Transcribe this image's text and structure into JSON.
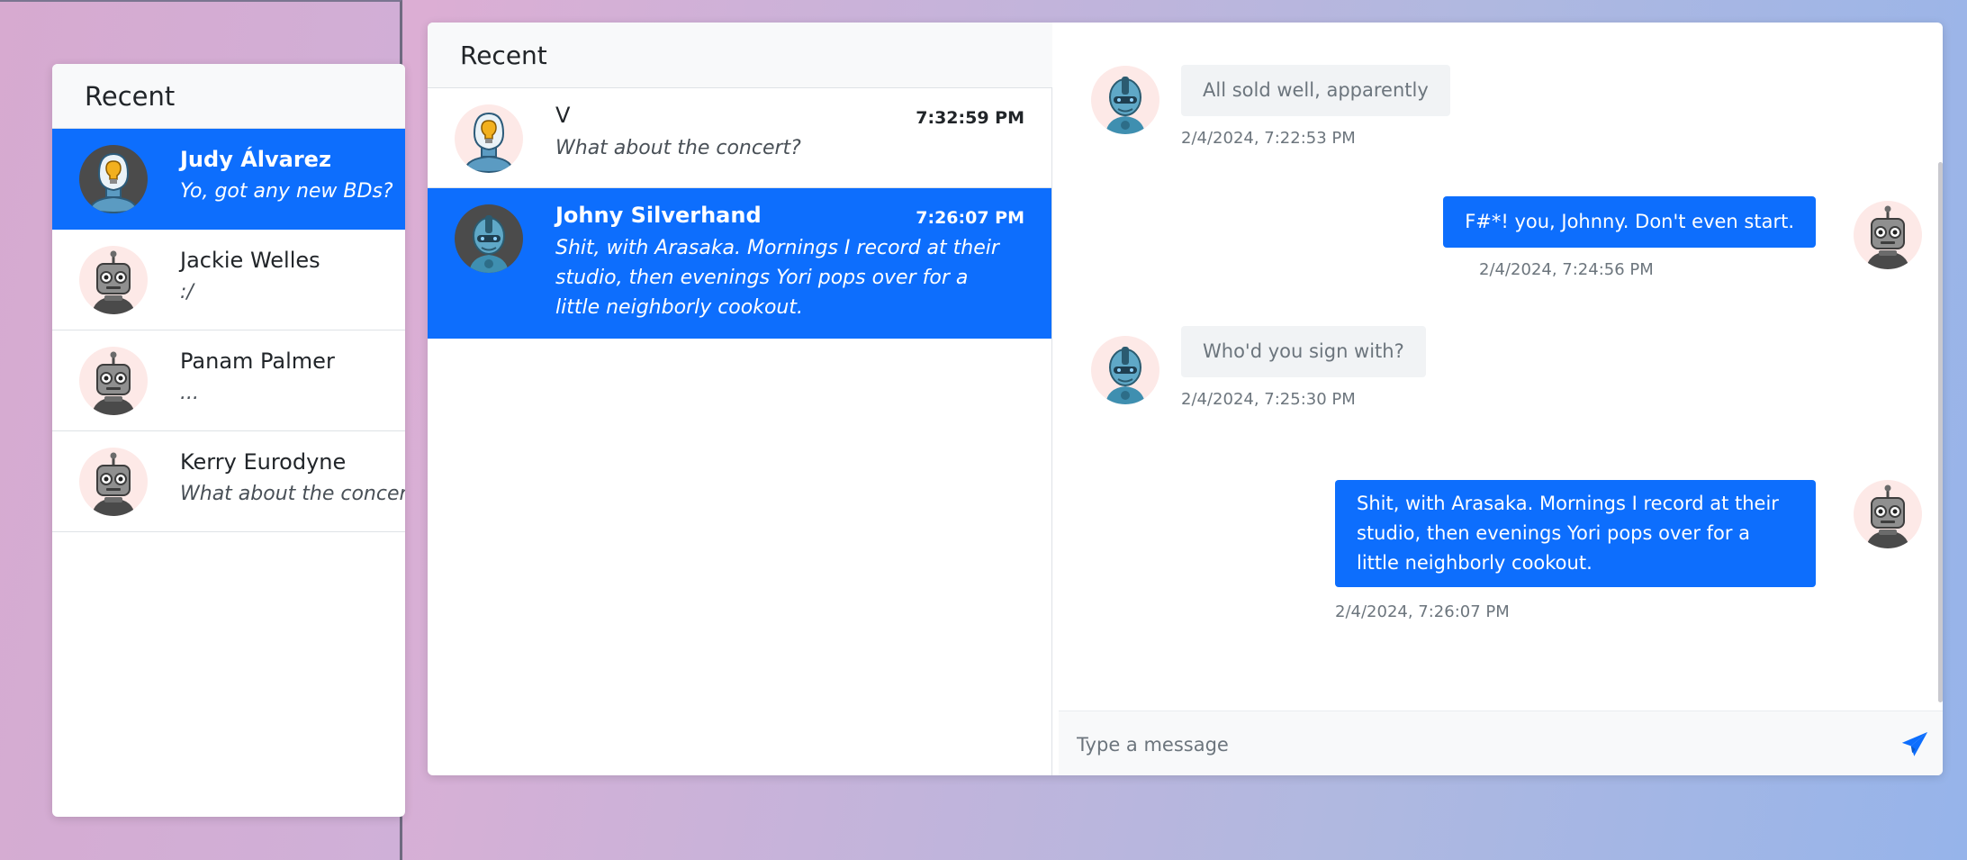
{
  "colors": {
    "accent": "#0d6efd",
    "muted": "#6c757d"
  },
  "left_panel": {
    "header": "Recent",
    "items": [
      {
        "name": "Judy Álvarez",
        "last": "Yo, got any new BDs?",
        "avatar": "lightbulb-robot-avatar",
        "active": true
      },
      {
        "name": "Jackie Welles",
        "last": ":/",
        "avatar": "gray-robot-avatar",
        "active": false
      },
      {
        "name": "Panam Palmer",
        "last": "...",
        "avatar": "gray-robot-avatar",
        "active": false
      },
      {
        "name": "Kerry Eurodyne",
        "last": "What about the concert?",
        "avatar": "gray-robot-avatar",
        "active": false
      }
    ]
  },
  "main_panel": {
    "header": "Recent",
    "items": [
      {
        "name": "V",
        "time": "7:32:59 PM",
        "last": "What about the concert?",
        "avatar": "lightbulb-robot-avatar",
        "active": false
      },
      {
        "name": "Johny Silverhand",
        "time": "7:26:07 PM",
        "last": "Shit, with Arasaka. Mornings I record at their studio, then evenings Yori pops over for a little neighborly cookout.",
        "avatar": "blue-robot-avatar",
        "active": true
      }
    ],
    "messages": [
      {
        "direction": "in",
        "text": "All sold well, apparently",
        "time": "2/4/2024, 7:22:53 PM",
        "avatar": "blue-robot-avatar"
      },
      {
        "direction": "out",
        "text": "F#*! you, Johnny. Don't even start.",
        "time": "2/4/2024, 7:24:56 PM",
        "avatar": "gray-robot-avatar"
      },
      {
        "direction": "in",
        "text": "Who'd you sign with?",
        "time": "2/4/2024, 7:25:30 PM",
        "avatar": "blue-robot-avatar"
      },
      {
        "direction": "out",
        "text": "Shit, with Arasaka. Mornings I record at their studio, then evenings Yori pops over for a little neighborly cookout.",
        "time": "2/4/2024, 7:26:07 PM",
        "avatar": "gray-robot-avatar"
      }
    ],
    "composer": {
      "placeholder": "Type a message",
      "send_icon": "paper-plane-icon"
    }
  }
}
